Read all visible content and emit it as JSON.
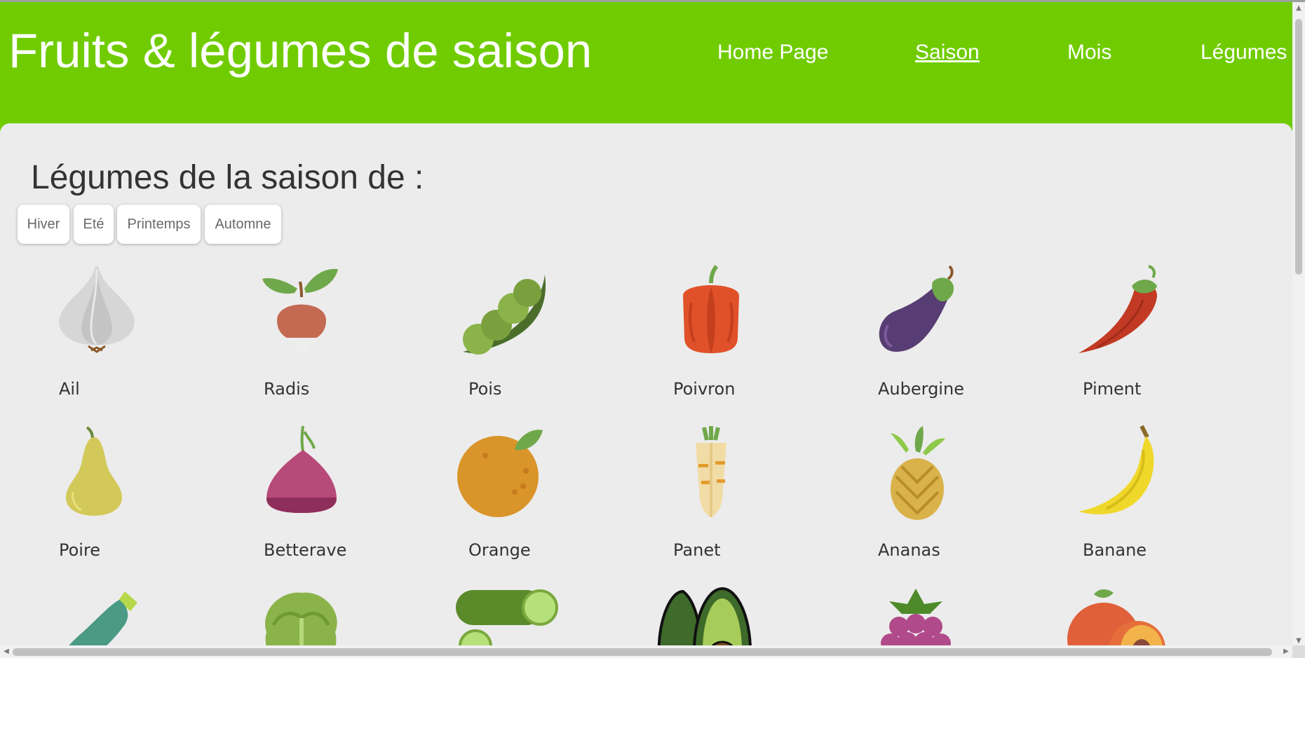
{
  "header": {
    "title": "Fruits & légumes de saison",
    "nav": [
      {
        "label": "Home Page",
        "active": false
      },
      {
        "label": "Saison",
        "active": true
      },
      {
        "label": "Mois",
        "active": false
      },
      {
        "label": "Légumes",
        "active": false
      }
    ]
  },
  "main": {
    "section_title": "Légumes de la saison de :",
    "season_buttons": [
      "Hiver",
      "Eté",
      "Printemps",
      "Automne"
    ],
    "items": [
      {
        "name": "Ail",
        "icon": "garlic-icon"
      },
      {
        "name": "Radis",
        "icon": "radish-icon"
      },
      {
        "name": "Pois",
        "icon": "pea-pod-icon"
      },
      {
        "name": "Poivron",
        "icon": "bell-pepper-icon"
      },
      {
        "name": "Aubergine",
        "icon": "eggplant-icon"
      },
      {
        "name": "Piment",
        "icon": "chili-pepper-icon"
      },
      {
        "name": "Poire",
        "icon": "pear-icon"
      },
      {
        "name": "Betterave",
        "icon": "beetroot-icon"
      },
      {
        "name": "Orange",
        "icon": "orange-icon"
      },
      {
        "name": "Panet",
        "icon": "parsnip-icon"
      },
      {
        "name": "Ananas",
        "icon": "pineapple-icon"
      },
      {
        "name": "Banane",
        "icon": "banana-icon"
      },
      {
        "name": "",
        "icon": "zucchini-icon"
      },
      {
        "name": "",
        "icon": "lettuce-icon"
      },
      {
        "name": "",
        "icon": "cucumber-icon"
      },
      {
        "name": "",
        "icon": "avocado-icon"
      },
      {
        "name": "",
        "icon": "raspberry-icon"
      },
      {
        "name": "",
        "icon": "peach-icon"
      }
    ]
  },
  "colors": {
    "header_bg": "#70cc00",
    "content_bg": "#ececec",
    "text": "#333333",
    "button_text": "#6a6a6a"
  }
}
